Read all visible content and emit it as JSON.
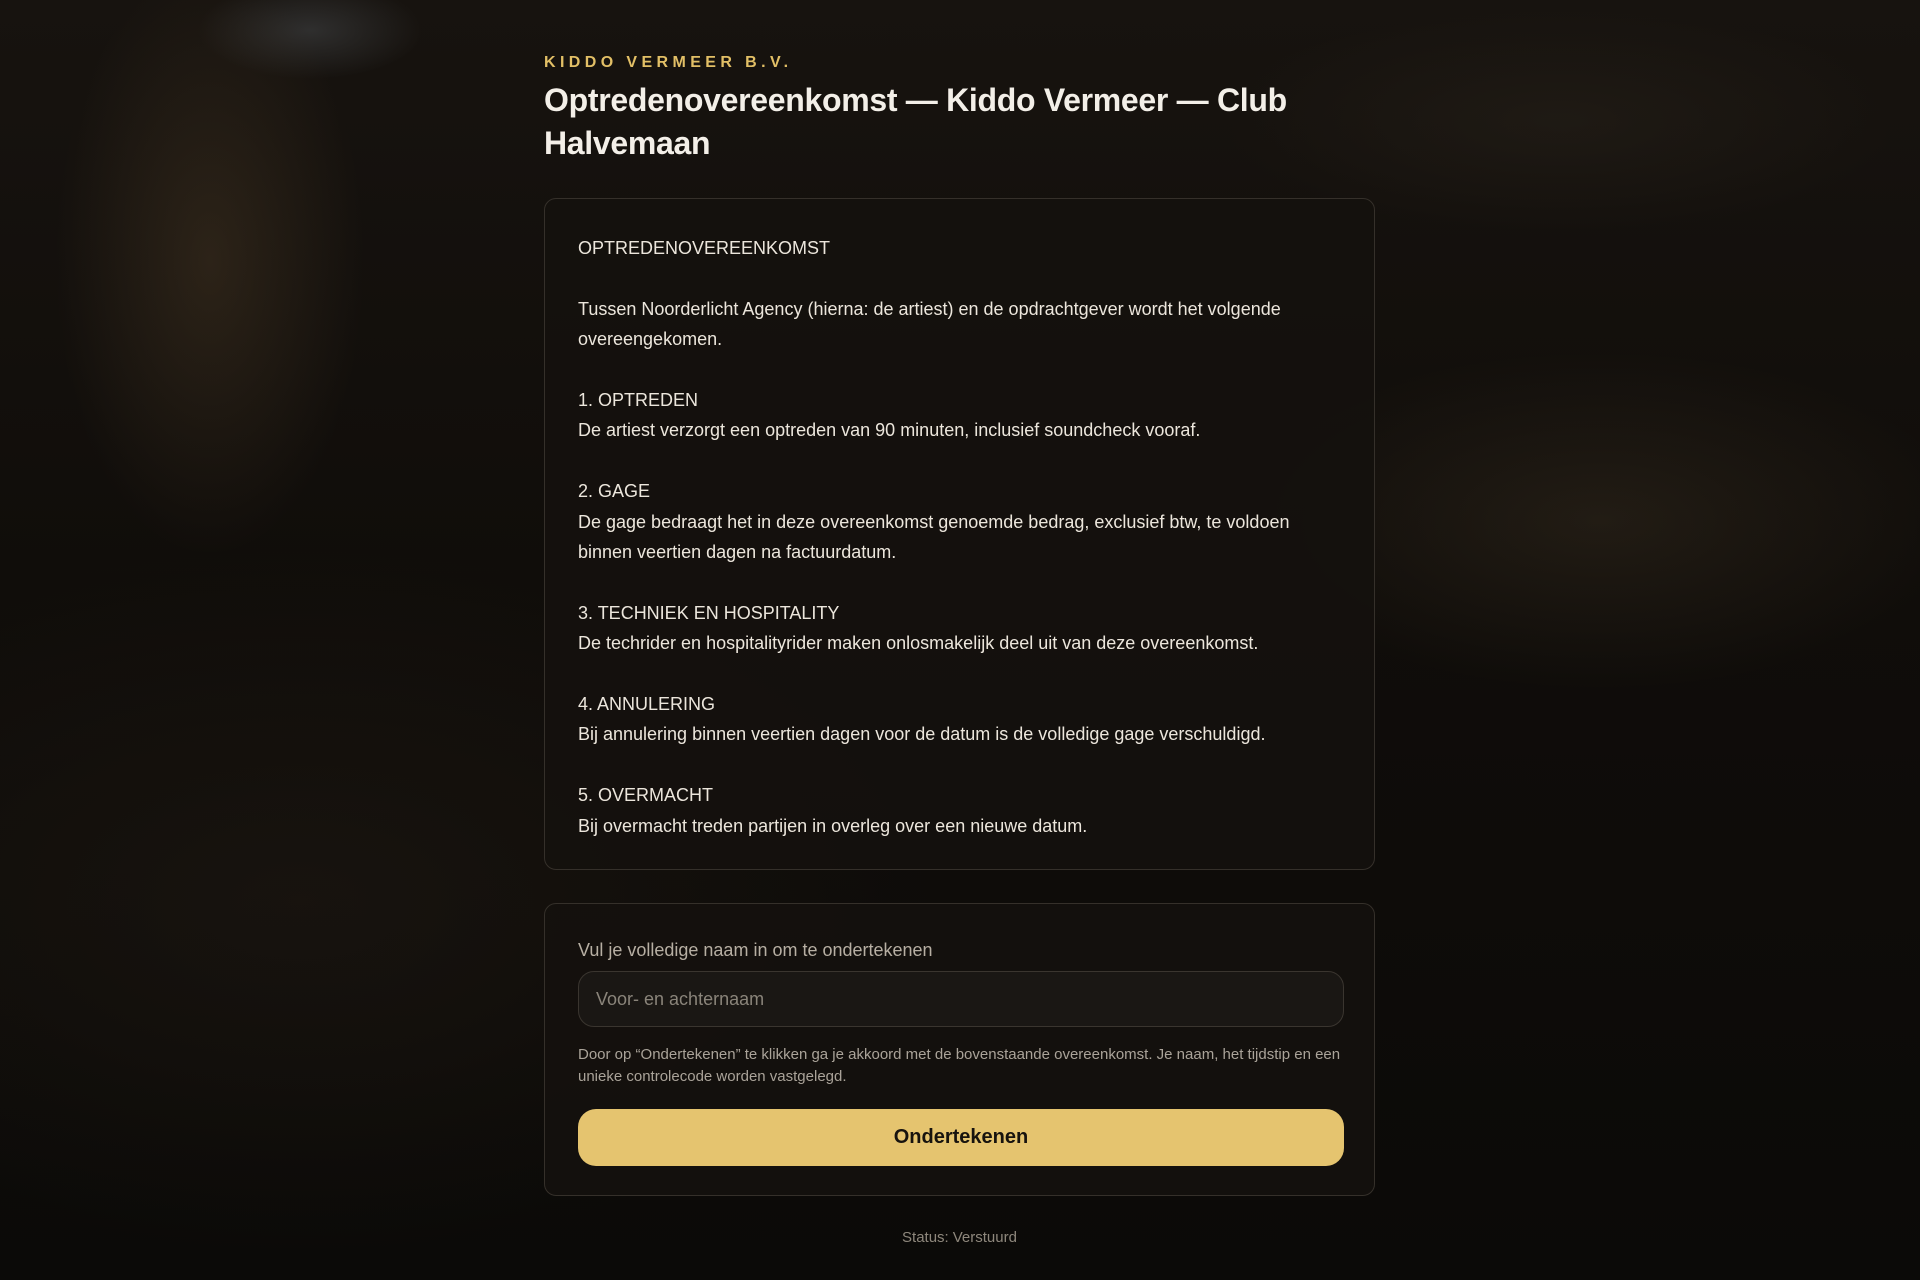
{
  "header": {
    "company": "KIDDO VERMEER B.V.",
    "title": "Optredenovereenkomst — Kiddo Vermeer — Club Halvemaan"
  },
  "contract": {
    "heading": "OPTREDENOVEREENKOMST",
    "intro": "Tussen Noorderlicht Agency (hierna: de artiest) en de opdrachtgever wordt het volgende overeengekomen.",
    "sections": [
      {
        "title": "1. OPTREDEN",
        "body": "De artiest verzorgt een optreden van 90 minuten, inclusief soundcheck vooraf."
      },
      {
        "title": "2. GAGE",
        "body": "De gage bedraagt het in deze overeenkomst genoemde bedrag, exclusief btw, te voldoen binnen veertien dagen na factuurdatum."
      },
      {
        "title": "3. TECHNIEK EN HOSPITALITY",
        "body": "De techrider en hospitalityrider maken onlosmakelijk deel uit van deze overeenkomst."
      },
      {
        "title": "4. ANNULERING",
        "body": "Bij annulering binnen veertien dagen voor de datum is de volledige gage verschuldigd."
      },
      {
        "title": "5. OVERMACHT",
        "body": "Bij overmacht treden partijen in overleg over een nieuwe datum."
      }
    ]
  },
  "signature": {
    "label": "Vul je volledige naam in om te ondertekenen",
    "input_value": "",
    "input_placeholder": "Voor- en achternaam",
    "consent": "Door op “Ondertekenen” te klikken ga je akkoord met de bovenstaande overeenkomst. Je naam, het tijdstip en een unieke controlecode worden vastgelegd.",
    "button_label": "Ondertekenen"
  },
  "status": {
    "label": "Status:",
    "value": "Verstuurd"
  },
  "colors": {
    "accent": "#e5c46f",
    "company_label": "#e2bf66",
    "background": "#0d0b09",
    "card_border": "#35302a"
  }
}
